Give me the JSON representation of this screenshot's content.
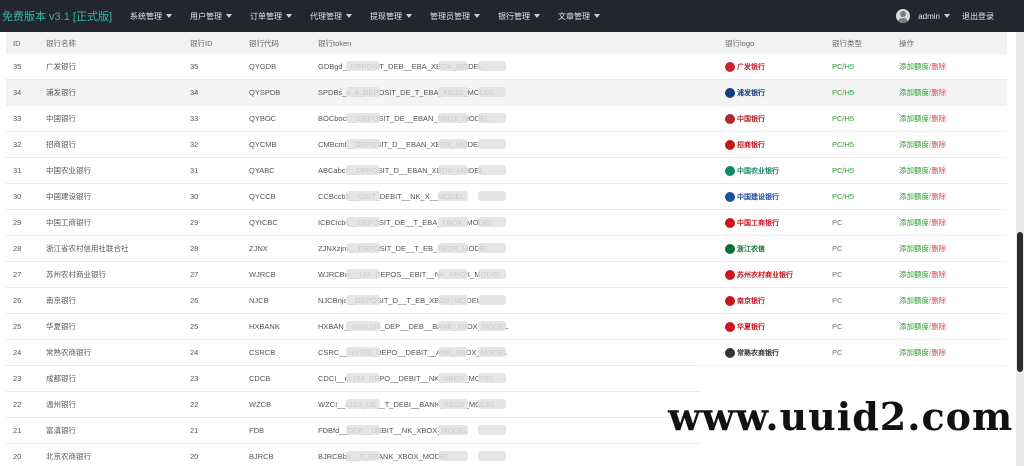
{
  "brand": {
    "title": "免费版本 v3.1 [正式版]"
  },
  "nav": [
    {
      "label": "系统管理"
    },
    {
      "label": "用户管理"
    },
    {
      "label": "订单管理"
    },
    {
      "label": "代理管理"
    },
    {
      "label": "提现管理"
    },
    {
      "label": "管理员管理"
    },
    {
      "label": "银行管理"
    },
    {
      "label": "文章管理"
    }
  ],
  "user": {
    "name": "admin",
    "logout": "退出登录"
  },
  "table": {
    "headers": [
      "ID",
      "银行名称",
      "银行ID",
      "银行代码",
      "银行token",
      "银行logo",
      "银行类型",
      "操作"
    ],
    "rows": [
      {
        "id": "35",
        "name": "广发银行",
        "bid": "35",
        "code": "QYGDB",
        "token": "GDBgd__DEPOSIT_DEB__EBA_XBOX_MODEL",
        "logo_text": "广发银行",
        "logo_color": "#c8242b",
        "type": "PC/H5",
        "add": "添加额度",
        "sep": "/",
        "del": "删除"
      },
      {
        "id": "34",
        "name": "浦发银行",
        "bid": "34",
        "code": "QYSPDB",
        "token": "SPDBs_u_4_DEPOSIT_DE_T_EBA_XBOX_MODEL",
        "logo_text": "浦发银行",
        "logo_color": "#163d7d",
        "type": "PC/H5",
        "add": "添加额度",
        "sep": "/",
        "del": "删除"
      },
      {
        "id": "33",
        "name": "中国银行",
        "bid": "33",
        "code": "QYBOC",
        "token": "BOCbocr__DEPOSIT_DE__EBAN_XBOX_MODEL",
        "logo_text": "中国银行",
        "logo_color": "#b3242a",
        "type": "PC/H5",
        "add": "添加额度",
        "sep": "/",
        "del": "删除"
      },
      {
        "id": "32",
        "name": "招商银行",
        "bid": "32",
        "code": "QYCMB",
        "token": "CMBcmt__DEPOSIT_D__EBAN_XBOX_MODEL",
        "logo_text": "招商银行",
        "logo_color": "#c4161c",
        "type": "PC/H5",
        "add": "添加额度",
        "sep": "/",
        "del": "删除"
      },
      {
        "id": "31",
        "name": "中国农业银行",
        "bid": "31",
        "code": "QYABC",
        "token": "ABCabcr__DEPOSIT_D__EBAN_XBOX_MODEL",
        "logo_text": "中国农业银行",
        "logo_color": "#0f8a6b",
        "type": "PC/H5",
        "add": "添加额度",
        "sep": "/",
        "del": "删除"
      },
      {
        "id": "30",
        "name": "中国建设银行",
        "bid": "30",
        "code": "QYCCB",
        "token": "CCBccb1__OSIT_DEBIT__NK_X__MODEL",
        "logo_text": "中国建设银行",
        "logo_color": "#1c4f9c",
        "type": "PC/H5",
        "add": "添加额度",
        "sep": "/",
        "del": "删除"
      },
      {
        "id": "29",
        "name": "中国工商银行",
        "bid": "29",
        "code": "QYICBC",
        "token": "ICBCicbc__DEPOSIT_DE__T_EBA_XBOX_MODEL",
        "logo_text": "中国工商银行",
        "logo_color": "#c7161c",
        "type": "PC",
        "add": "添加额度",
        "sep": "/",
        "del": "删除"
      },
      {
        "id": "28",
        "name": "浙江省农村信用社联合社",
        "bid": "28",
        "code": "ZJNX",
        "token": "ZJNXzjnx__DEPOSIT_DE__T_EB_XBOX_MODEL",
        "logo_text": "浙江农信",
        "logo_color": "#0b6d3a",
        "type": "PC",
        "add": "添加额度",
        "sep": "/",
        "del": "删除"
      },
      {
        "id": "27",
        "name": "苏州农村商业银行",
        "bid": "27",
        "code": "WJRCB",
        "token": "WJRCBw__103_DEPOS__EBIT__NK_XBOX_MODEL",
        "logo_text": "苏州农村商业银行",
        "logo_color": "#c7161c",
        "type": "PC",
        "add": "添加额度",
        "sep": "/",
        "del": "删除"
      },
      {
        "id": "26",
        "name": "南京银行",
        "bid": "26",
        "code": "NJCB",
        "token": "NJCBnjc__DEPOSIT_D__T_EB_XBOX_MODEL",
        "logo_text": "南京银行",
        "logo_color": "#c7161c",
        "type": "PC",
        "add": "添加额度",
        "sep": "/",
        "del": "删除"
      },
      {
        "id": "25",
        "name": "华夏银行",
        "bid": "25",
        "code": "HXBANK",
        "token": "HXBAN__nucc103_DEP__DEB__BANK_XBOX_MODEL",
        "logo_text": "华夏银行",
        "logo_color": "#d0121b",
        "type": "PC",
        "add": "添加额度",
        "sep": "/",
        "del": "删除"
      },
      {
        "id": "24",
        "name": "常熟农商银行",
        "bid": "24",
        "code": "CSRCB",
        "token": "CSRC__ucc103_DEPO__DEBIT__ANK_XBOX_MODEL",
        "logo_text": "常熟农商银行",
        "logo_color": "#333333",
        "type": "PC",
        "add": "添加额度",
        "sep": "/",
        "del": "删除"
      },
      {
        "id": "23",
        "name": "成都银行",
        "bid": "23",
        "code": "CDCB",
        "token": "CDCI__cc103_DEPO__DEBIT__NK_XBOX_MODEL",
        "logo_text": "",
        "logo_color": "",
        "type": "",
        "add": "",
        "sep": "",
        "del": ""
      },
      {
        "id": "22",
        "name": "温州银行",
        "bid": "22",
        "code": "WZCB",
        "token": "WZCI__c103_DE__T_DEBI__BANK_XBOX_MODEL",
        "logo_text": "",
        "logo_color": "",
        "type": "",
        "add": "",
        "sep": "",
        "del": ""
      },
      {
        "id": "21",
        "name": "富滇银行",
        "bid": "21",
        "code": "FDB",
        "token": "FDBfd__DEP__DEBIT__NK_XBOX_MODEL",
        "logo_text": "",
        "logo_color": "",
        "type": "",
        "add": "",
        "sep": "",
        "del": ""
      },
      {
        "id": "20",
        "name": "北京农商银行",
        "bid": "20",
        "code": "BJRCB",
        "token": "BJRCBbjr__T_EBANK_XBOX_MODEL",
        "logo_text": "",
        "logo_color": "",
        "type": "",
        "add": "",
        "sep": "",
        "del": ""
      }
    ]
  },
  "watermark": {
    "text": "www.uuid2.com"
  },
  "colors": {
    "nav_bg": "#23262e",
    "brand": "#2fb8a8",
    "ok": "#2a9a2a",
    "danger": "#e34848"
  }
}
